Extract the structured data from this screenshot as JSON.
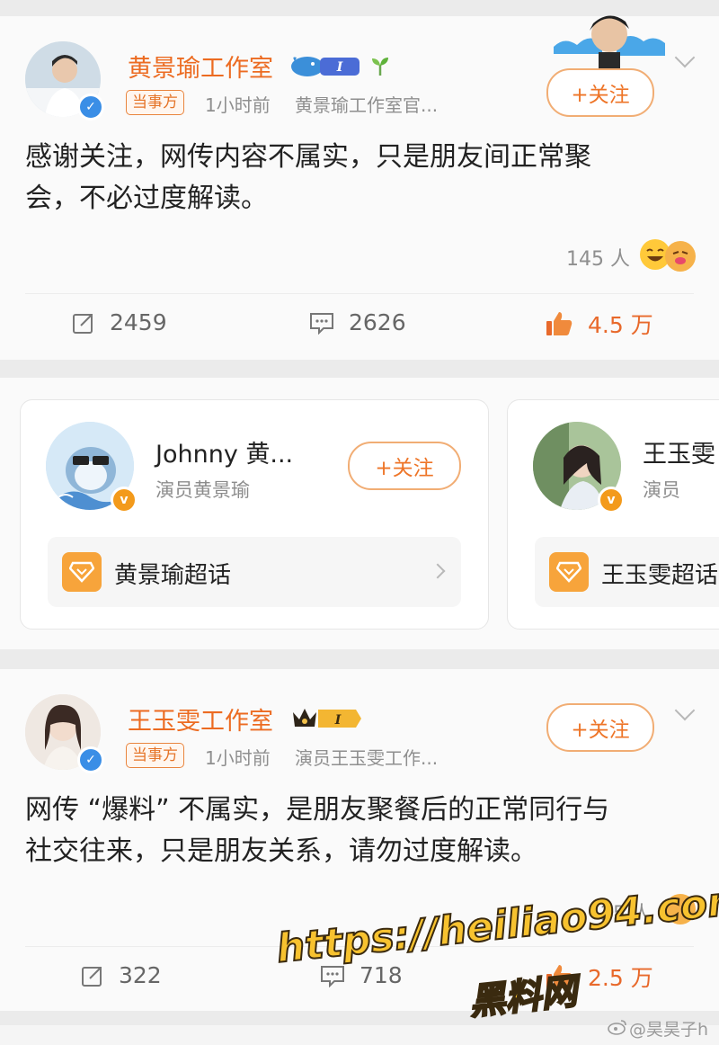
{
  "post1": {
    "name": "黄景瑜工作室",
    "level_badge": "I",
    "tag": "当事方",
    "time": "1小时前",
    "source": "黄景瑜工作室官...",
    "follow_label": "+关注",
    "content_line1": "感谢关注，网传内容不属实，只是朋友间正常聚",
    "content_line2": "会，不必过度解读。",
    "reactors": "145 人",
    "repost_count": "2459",
    "comment_count": "2626",
    "like_count": "4.5 万"
  },
  "suggestions": [
    {
      "name": "Johnny 黄...",
      "desc": "演员黄景瑜",
      "follow_label": "+关注",
      "topic": "黄景瑜超话"
    },
    {
      "name": "王玉雯",
      "desc": "演员",
      "topic": "王玉雯超话"
    }
  ],
  "post2": {
    "name": "王玉雯工作室",
    "level_badge": "I",
    "tag": "当事方",
    "time": "1小时前",
    "source": "演员王玉雯工作...",
    "follow_label": "+关注",
    "content_line1": "网传 “爆料” 不属实，是朋友聚餐后的正常同行与",
    "content_line2": "社交往来，只是朋友关系，请勿过度解读。",
    "reactors": "25 人",
    "repost_count": "322",
    "comment_count": "718",
    "like_count": "2.5 万"
  },
  "watermark": {
    "url": "https://heiliao94.com",
    "site_name": "黑料网",
    "credit": "@昊昊子h"
  },
  "colors": {
    "accent_orange": "#ec6b21",
    "verified_blue": "#3a8ee6",
    "verified_gold": "#f39a1b",
    "watermark_yellow": "#f7c22f"
  }
}
